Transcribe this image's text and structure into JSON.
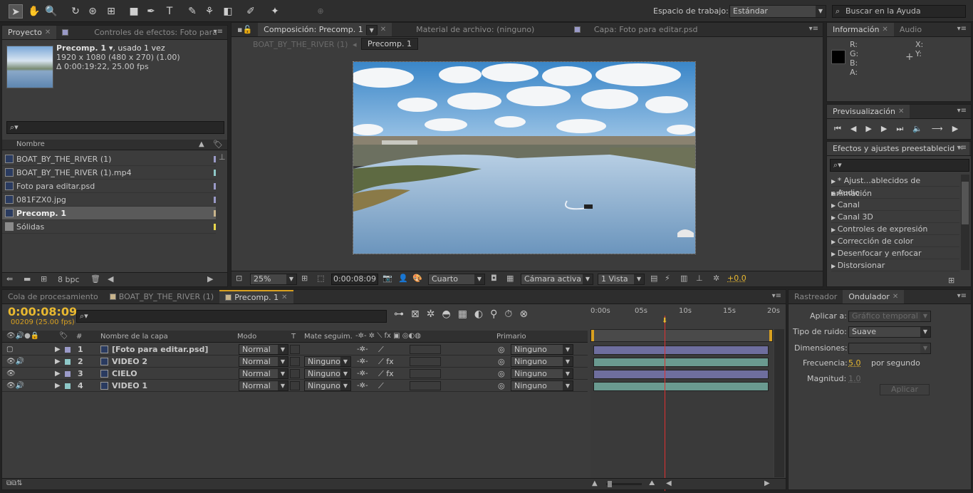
{
  "toolbar": {
    "workspace_label": "Espacio de trabajo:",
    "workspace_value": "Estándar",
    "search_placeholder": "Buscar en la Ayuda"
  },
  "project": {
    "tab_project": "Proyecto",
    "tab_effects": "Controles de efectos: Foto para",
    "comp_name": "Precomp. 1",
    "usage": ", usado 1 vez",
    "dims": "1920 x 1080  (480 x 270) (1.00)",
    "duration": "Δ 0:00:19:22, 25.00 fps",
    "col_name": "Nombre",
    "bpc": "8 bpc",
    "items": [
      {
        "name": "BOAT_BY_THE_RIVER (1)",
        "color": "#9a9ac8",
        "selected": false
      },
      {
        "name": "BOAT_BY_THE_RIVER (1).mp4",
        "color": "#8ec8c8",
        "selected": false
      },
      {
        "name": "Foto para editar.psd",
        "color": "#9a9ac8",
        "selected": false
      },
      {
        "name": "081FZX0.jpg",
        "color": "#9a9ac8",
        "selected": false
      },
      {
        "name": "Precomp. 1",
        "color": "#c8b48c",
        "selected": true
      },
      {
        "name": "Sólidas",
        "color": "#e8d64c",
        "selected": false
      }
    ]
  },
  "comp": {
    "tab_comp": "Composición: Precomp. 1",
    "tab_footage": "Material de archivo: (ninguno)",
    "tab_layer": "Capa: Foto para editar.psd",
    "crumb1": "BOAT_BY_THE_RIVER (1)",
    "crumb2": "Precomp. 1",
    "zoom": "25%",
    "timecode": "0:00:08:09",
    "resolution": "Cuarto",
    "camera": "Cámara activa",
    "views": "1 Vista",
    "exposure": "+0.0"
  },
  "info": {
    "tab_info": "Información",
    "tab_audio": "Audio",
    "r": "R:",
    "g": "G:",
    "b": "B:",
    "a": "A:",
    "x": "X:",
    "y": "Y:"
  },
  "preview": {
    "tab": "Previsualización"
  },
  "effects": {
    "tab": "Efectos y ajustes preestablecid",
    "items": [
      "* Ajust...ablecidos de animación",
      "Audio",
      "Canal",
      "Canal 3D",
      "Controles de expresión",
      "Corrección de color",
      "Desenfocar y enfocar",
      "Distorsionar"
    ]
  },
  "timeline": {
    "tab_render": "Cola de procesamiento",
    "tab_boat": "BOAT_BY_THE_RIVER (1)",
    "tab_precomp": "Precomp. 1",
    "timecode": "0:00:08:09",
    "frames": "00209 (25.00 fps)",
    "col_num": "#",
    "col_name": "Nombre de la capa",
    "col_mode": "Modo",
    "col_t": "T",
    "col_matte": "Mate seguim.",
    "col_parent": "Primario",
    "ruler": [
      "0:00s",
      "05s",
      "10s",
      "15s",
      "20s"
    ],
    "layers": [
      {
        "num": "1",
        "name": "[Foto para editar.psd]",
        "mode": "Normal",
        "matte": "",
        "parent": "Ninguno",
        "color": "#9a9ac8",
        "bar": "#6e6e9e"
      },
      {
        "num": "2",
        "name": "VIDEO 2",
        "mode": "Normal",
        "matte": "Ninguno",
        "parent": "Ninguno",
        "color": "#8ec8c8",
        "bar": "#6a9a90"
      },
      {
        "num": "3",
        "name": "CIELO",
        "mode": "Normal",
        "matte": "Ninguno",
        "parent": "Ninguno",
        "color": "#9a9ac8",
        "bar": "#6e6e9e"
      },
      {
        "num": "4",
        "name": "VIDEO 1",
        "mode": "Normal",
        "matte": "Ninguno",
        "parent": "Ninguno",
        "color": "#8ec8c8",
        "bar": "#6a9a90"
      }
    ]
  },
  "wiggler": {
    "tab_tracker": "Rastreador",
    "tab_wiggler": "Ondulador",
    "apply_label": "Aplicar a:",
    "apply_value": "Gráfico temporal",
    "noise_label": "Tipo de ruido:",
    "noise_value": "Suave",
    "dims_label": "Dimensiones:",
    "freq_label": "Frecuencia:",
    "freq_value": "5.0",
    "freq_unit": "por segundo",
    "mag_label": "Magnitud:",
    "mag_value": "1.0",
    "apply_button": "Aplicar"
  }
}
